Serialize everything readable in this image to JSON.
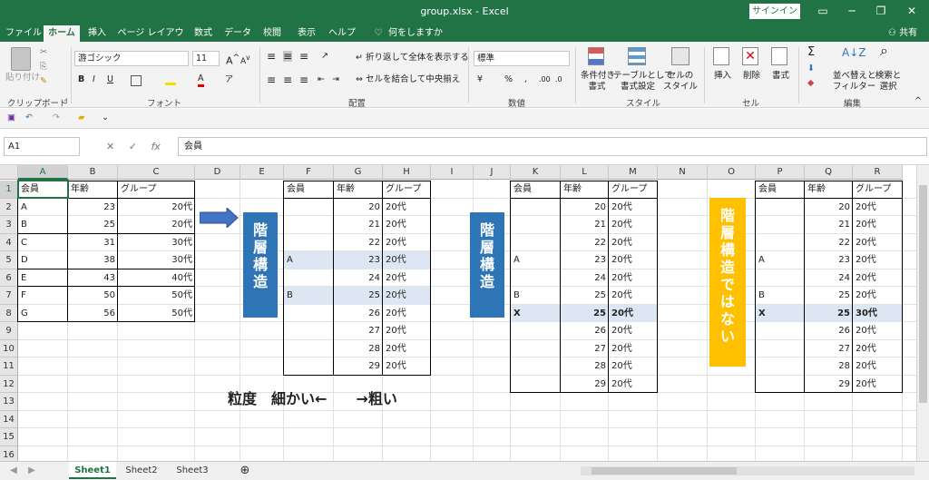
{
  "window": {
    "title": "group.xlsx  -  Excel",
    "signin": "サインイン",
    "share": "共有"
  },
  "tabs": [
    "ファイル",
    "ホーム",
    "挿入",
    "ページ レイアウト",
    "数式",
    "データ",
    "校閲",
    "表示",
    "ヘルプ",
    "何をしますか"
  ],
  "ribbon": {
    "clipboard": {
      "label": "クリップボード",
      "paste": "貼り付け"
    },
    "font": {
      "label": "フォント",
      "name": "游ゴシック",
      "size": "11"
    },
    "alignment": {
      "label": "配置",
      "wrap": "折り返して全体を表示する",
      "merge": "セルを結合して中央揃え"
    },
    "number": {
      "label": "数値",
      "format": "標準"
    },
    "styles": {
      "label": "スタイル",
      "cond": "条件付き\n書式",
      "table": "テーブルとして\n書式設定",
      "cell": "セルの\nスタイル"
    },
    "cells": {
      "label": "セル",
      "insert": "挿入",
      "delete": "削除",
      "format": "書式"
    },
    "editing": {
      "label": "編集",
      "sort": "並べ替えと\nフィルター",
      "find": "検索と\n選択"
    }
  },
  "formula_bar": {
    "name_box": "A1",
    "fx": "fx",
    "content": "会員"
  },
  "columns": [
    "A",
    "B",
    "C",
    "D",
    "E",
    "F",
    "G",
    "H",
    "I",
    "J",
    "K",
    "L",
    "M",
    "N",
    "O",
    "P",
    "Q",
    "R"
  ],
  "rows": [
    "1",
    "2",
    "3",
    "4",
    "5",
    "6",
    "7",
    "8",
    "9",
    "10",
    "11",
    "12",
    "13",
    "14",
    "15",
    "16"
  ],
  "table1": {
    "header": [
      "会員",
      "年齢",
      "グループ"
    ],
    "rows": [
      [
        "A",
        "23",
        "20代"
      ],
      [
        "B",
        "25",
        "20代"
      ],
      [
        "C",
        "31",
        "30代"
      ],
      [
        "D",
        "38",
        "30代"
      ],
      [
        "E",
        "43",
        "40代"
      ],
      [
        "F",
        "50",
        "50代"
      ],
      [
        "G",
        "56",
        "50代"
      ]
    ]
  },
  "table2": {
    "header": [
      "会員",
      "年齢",
      "グループ"
    ],
    "rows": [
      [
        "",
        "20",
        "20代"
      ],
      [
        "",
        "21",
        "20代"
      ],
      [
        "",
        "22",
        "20代"
      ],
      [
        "A",
        "23",
        "20代"
      ],
      [
        "",
        "24",
        "20代"
      ],
      [
        "B",
        "25",
        "20代"
      ],
      [
        "",
        "26",
        "20代"
      ],
      [
        "",
        "27",
        "20代"
      ],
      [
        "",
        "28",
        "20代"
      ],
      [
        "",
        "29",
        "20代"
      ]
    ]
  },
  "table3": {
    "header": [
      "会員",
      "年齢",
      "グループ"
    ],
    "rows": [
      [
        "",
        "20",
        "20代"
      ],
      [
        "",
        "21",
        "20代"
      ],
      [
        "",
        "22",
        "20代"
      ],
      [
        "A",
        "23",
        "20代"
      ],
      [
        "",
        "24",
        "20代"
      ],
      [
        "B",
        "25",
        "20代"
      ],
      [
        "X",
        "25",
        "20代"
      ],
      [
        "",
        "26",
        "20代"
      ],
      [
        "",
        "27",
        "20代"
      ],
      [
        "",
        "28",
        "20代"
      ],
      [
        "",
        "29",
        "20代"
      ]
    ]
  },
  "table4": {
    "header": [
      "会員",
      "年齢",
      "グループ"
    ],
    "rows": [
      [
        "",
        "20",
        "20代"
      ],
      [
        "",
        "21",
        "20代"
      ],
      [
        "",
        "22",
        "20代"
      ],
      [
        "A",
        "23",
        "20代"
      ],
      [
        "",
        "24",
        "20代"
      ],
      [
        "B",
        "25",
        "20代"
      ],
      [
        "X",
        "25",
        "30代"
      ],
      [
        "",
        "26",
        "20代"
      ],
      [
        "",
        "27",
        "20代"
      ],
      [
        "",
        "28",
        "20代"
      ],
      [
        "",
        "29",
        "20代"
      ]
    ]
  },
  "labels": {
    "hier1": "階\n層\n構\n造",
    "hier2": "階\n層\n構\n造",
    "nonhier": "階\n層\n構\n造\nで\nは\nな\nい",
    "granularity": "粒度　細かい←　　→粗い"
  },
  "sheets": [
    "Sheet1",
    "Sheet2",
    "Sheet3"
  ],
  "colors": {
    "excel_green": "#217346",
    "blue_label": "#2e75b6",
    "yellow_label": "#ffc000",
    "highlight": "#dde6f3"
  }
}
